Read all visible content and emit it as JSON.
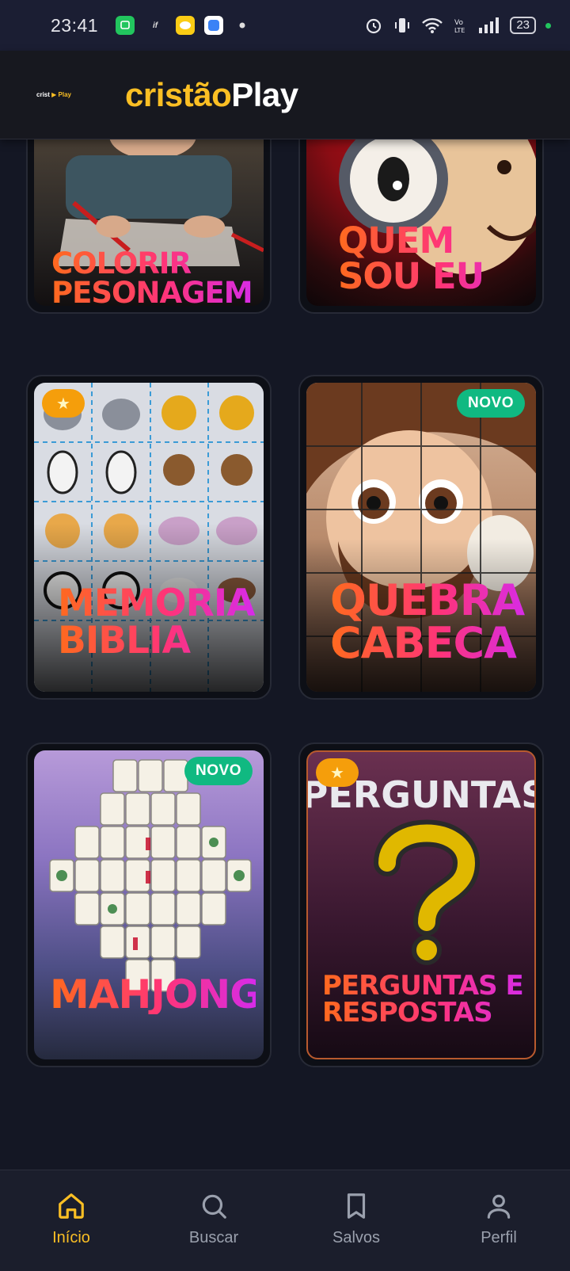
{
  "status_bar": {
    "time": "23:41",
    "battery": "23"
  },
  "header": {
    "small_logo_a": "crist",
    "small_logo_b": "Play",
    "brand_part1": "cristão",
    "brand_part2": "Play"
  },
  "cards": [
    {
      "title_line1": "COLORIR",
      "title_line2": "PESONAGEM"
    },
    {
      "title_line1": "QUEM",
      "title_line2": "SOU EU"
    },
    {
      "title_line1": "MEMORIA",
      "title_line2": "BIBLIA",
      "badge": "star"
    },
    {
      "title_line1": "QUEBRA",
      "title_line2": "CABECA",
      "badge": "NOVO"
    },
    {
      "title_line1": "MAHJONG",
      "title_line2": "",
      "badge": "NOVO"
    },
    {
      "title_line1": "PERGUNTAS E",
      "title_line2": "RESPOSTAS",
      "badge": "star",
      "art_text": "PERGUNTAS"
    }
  ],
  "bottom_nav": [
    {
      "label": "Início",
      "icon": "home-icon",
      "active": true
    },
    {
      "label": "Buscar",
      "icon": "search-icon",
      "active": false
    },
    {
      "label": "Salvos",
      "icon": "bookmark-icon",
      "active": false
    },
    {
      "label": "Perfil",
      "icon": "user-icon",
      "active": false
    }
  ],
  "colors": {
    "accent": "#fbbf24",
    "background": "#141724",
    "novo_badge": "#10b981",
    "star_badge": "#f59e0b"
  }
}
